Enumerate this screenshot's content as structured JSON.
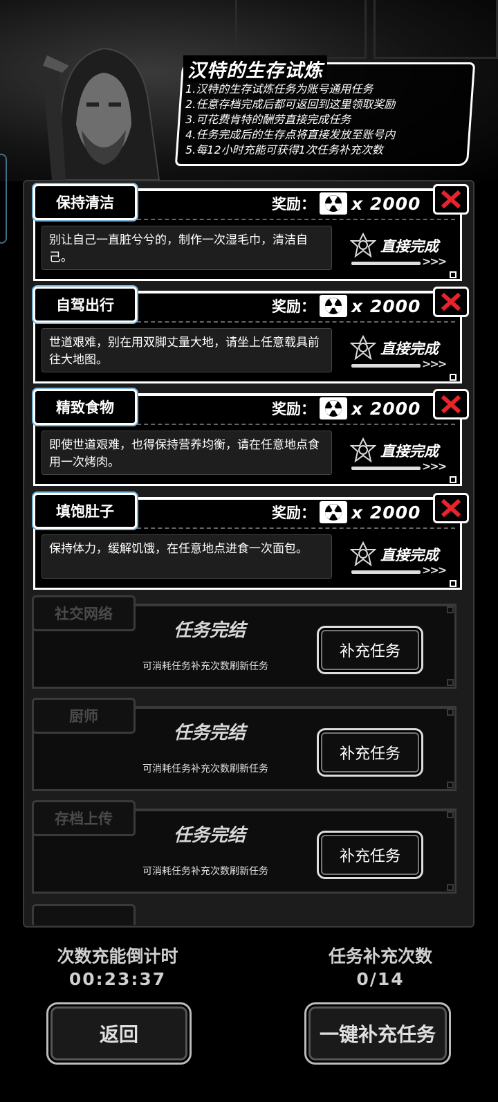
{
  "info": {
    "title": "汉特的生存试炼",
    "lines": [
      "1.汉特的生存试炼任务为账号通用任务",
      "2.任意存档完成后都可返回到这里领取奖励",
      "3.可花费肯特的酬劳直接完成任务",
      "4.任务完成后的生存点将直接发放至账号内",
      "5.每12小时充能可获得1次任务补充次数"
    ]
  },
  "reward_label": "奖励：",
  "direct_complete_label": "直接完成",
  "active_tasks": [
    {
      "name": "保持清洁",
      "reward": "x 2000",
      "desc": "别让自己一直脏兮兮的，制作一次湿毛巾，清洁自己。"
    },
    {
      "name": "自驾出行",
      "reward": "x 2000",
      "desc": "世道艰难，别在用双脚丈量大地，请坐上任意载具前往大地图。"
    },
    {
      "name": "精致食物",
      "reward": "x 2000",
      "desc": "即使世道艰难，也得保持营养均衡，请在任意地点食用一次烤肉。"
    },
    {
      "name": "填饱肚子",
      "reward": "x 2000",
      "desc": "保持体力，缓解饥饿，在任意地点进食一次面包。"
    }
  ],
  "done_tasks": [
    {
      "name": "社交网络",
      "status": "任务完结",
      "hint": "可消耗任务补充次数刷新任务",
      "button": "补充任务"
    },
    {
      "name": "厨师",
      "status": "任务完结",
      "hint": "可消耗任务补充次数刷新任务",
      "button": "补充任务"
    },
    {
      "name": "存档上传",
      "status": "任务完结",
      "hint": "可消耗任务补充次数刷新任务",
      "button": "补充任务"
    }
  ],
  "countdown": {
    "label": "次数充能倒计时",
    "value": "00:23:37"
  },
  "refill_count": {
    "label": "任务补充次数",
    "value": "0/14"
  },
  "buttons": {
    "back": "返回",
    "refill_all": "一键补充任务"
  },
  "colors": {
    "tab_glow": "#7bb5d9",
    "close_x": "#e8232a",
    "panel_bg": "#1c1c1c"
  }
}
